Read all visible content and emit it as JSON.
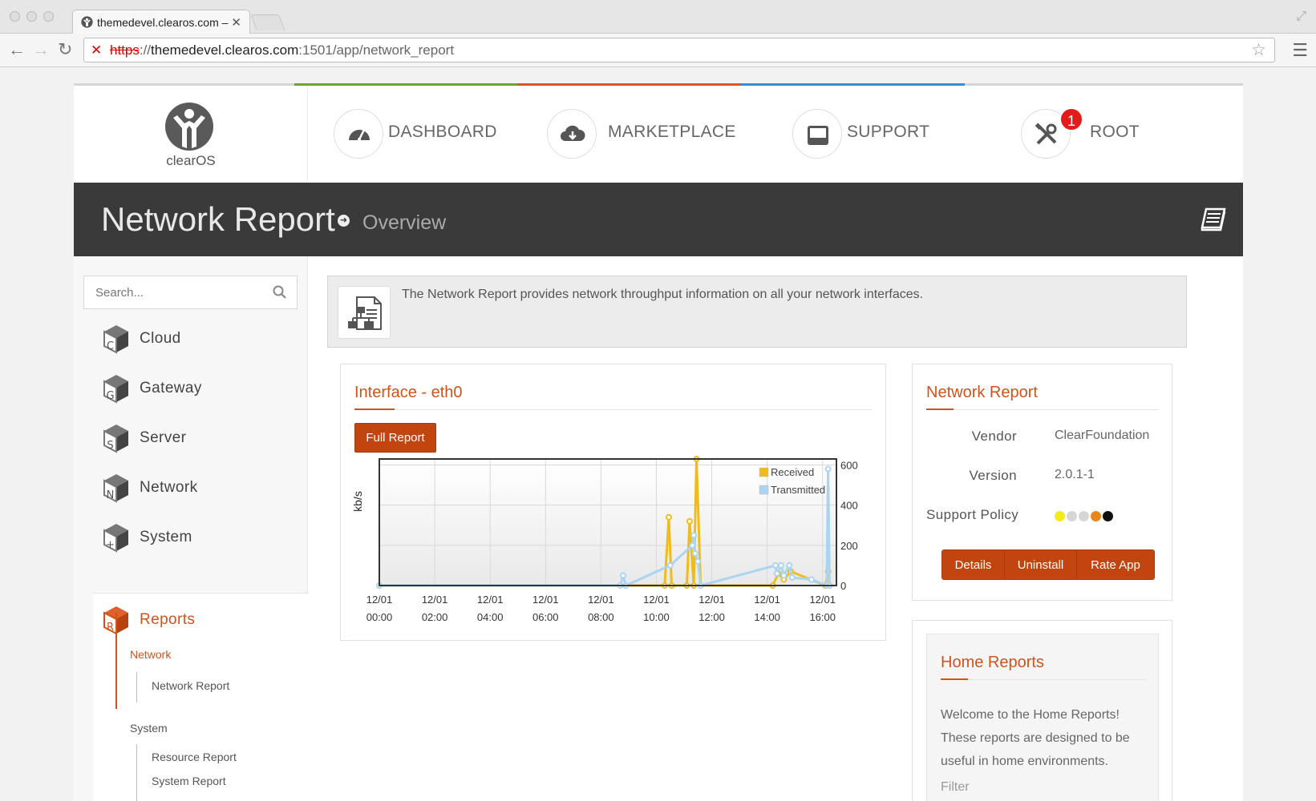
{
  "browser": {
    "tab_title": "themedevel.clearos.com –",
    "url_scheme": "https",
    "url_sep": "://",
    "url_host": "themedevel.clearos.com",
    "url_path": ":1501/app/network_report"
  },
  "brand": {
    "logo_text": "clearOS"
  },
  "topnav": [
    {
      "label": "DASHBOARD",
      "icon": "speedometer-icon"
    },
    {
      "label": "MARKETPLACE",
      "icon": "cloud-download-icon"
    },
    {
      "label": "SUPPORT",
      "icon": "inbox-icon"
    },
    {
      "label": "ROOT",
      "icon": "tools-icon",
      "badge": "1"
    }
  ],
  "colors": {
    "accent": "#d0531a",
    "bar_green": "#6aa820",
    "bar_orange": "#e0531c",
    "bar_blue": "#2f8fdc",
    "bar_grey": "#d6d6d6"
  },
  "header": {
    "title": "Network Report",
    "breadcrumb": "Overview"
  },
  "sidebar": {
    "search_placeholder": "Search...",
    "categories": [
      {
        "label": "Cloud",
        "letter": "C"
      },
      {
        "label": "Gateway",
        "letter": "G"
      },
      {
        "label": "Server",
        "letter": "S"
      },
      {
        "label": "Network",
        "letter": "N"
      },
      {
        "label": "System",
        "letter": "+"
      }
    ],
    "active": {
      "label": "Reports",
      "letter": "R"
    },
    "groups": [
      {
        "heading": "Network",
        "items": [
          "Network Report"
        ]
      },
      {
        "heading": "System",
        "items": [
          "Resource Report",
          "System Report"
        ]
      }
    ]
  },
  "info": {
    "text": "The Network Report provides network throughput information on all your network interfaces."
  },
  "chart_panel": {
    "title": "Interface - eth0",
    "button": "Full Report"
  },
  "chart_data": {
    "type": "line",
    "title": "",
    "ylabel": "kb/s",
    "xlabel": "",
    "ylim": [
      0,
      630
    ],
    "xlim": [
      0,
      16.5
    ],
    "y_axis_side": "right",
    "yticks": [
      0,
      200,
      400,
      600
    ],
    "xtick_labels": [
      [
        "12/01",
        "00:00"
      ],
      [
        "12/01",
        "02:00"
      ],
      [
        "12/01",
        "04:00"
      ],
      [
        "12/01",
        "06:00"
      ],
      [
        "12/01",
        "08:00"
      ],
      [
        "12/01",
        "10:00"
      ],
      [
        "12/01",
        "12:00"
      ],
      [
        "12/01",
        "14:00"
      ],
      [
        "12/01",
        "16:00"
      ]
    ],
    "xtick_hours": [
      0,
      2,
      4,
      6,
      8,
      10,
      12,
      14,
      16
    ],
    "legend_position": "top-right",
    "grid": true,
    "series": [
      {
        "name": "Received",
        "color": "#f0bc1d",
        "x": [
          0,
          10.3,
          10.45,
          10.55,
          11.1,
          11.2,
          11.35,
          11.45,
          11.6,
          14.2,
          14.4,
          14.6,
          14.85,
          16.1,
          16.2,
          16.25
        ],
        "y": [
          0,
          0,
          340,
          0,
          0,
          320,
          0,
          630,
          0,
          0,
          60,
          30,
          70,
          0,
          70,
          0
        ]
      },
      {
        "name": "Transmitted",
        "color": "#a9d4f2",
        "x": [
          0,
          8.7,
          8.8,
          8.9,
          10.5,
          11.3,
          11.35,
          11.4,
          11.5,
          11.6,
          14.3,
          14.35,
          14.5,
          14.6,
          14.8,
          14.9,
          15.6,
          16.15,
          16.2,
          16.25
        ],
        "y": [
          0,
          0,
          50,
          0,
          100,
          200,
          250,
          160,
          120,
          0,
          100,
          60,
          100,
          50,
          100,
          40,
          30,
          0,
          580,
          0
        ]
      }
    ]
  },
  "app_details": {
    "title": "Network Report",
    "vendor_label": "Vendor",
    "vendor": "ClearFoundation",
    "version_label": "Version",
    "version": "2.0.1-1",
    "support_label": "Support Policy",
    "support_dots": [
      "#f5ea1e",
      "#d6d6d6",
      "#d6d6d6",
      "#e8861a",
      "#111111"
    ],
    "buttons": [
      "Details",
      "Uninstall",
      "Rate App"
    ]
  },
  "home_reports": {
    "title": "Home Reports",
    "text": "Welcome to the Home Reports! These reports are designed to be useful in home environments.",
    "filter": "Filter"
  }
}
